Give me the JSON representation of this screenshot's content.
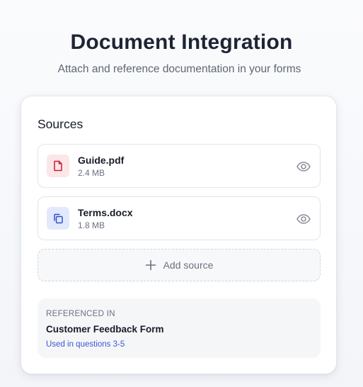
{
  "header": {
    "title": "Document Integration",
    "subtitle": "Attach and reference documentation in your forms"
  },
  "sources": {
    "title": "Sources",
    "items": [
      {
        "name": "Guide.pdf",
        "size": "2.4 MB",
        "icon": "pdf-file-icon",
        "icon_color": "#c81e3a",
        "icon_bg": "#fde6e7"
      },
      {
        "name": "Terms.docx",
        "size": "1.8 MB",
        "icon": "copy-document-icon",
        "icon_color": "#2f4fcf",
        "icon_bg": "#e2e9fd"
      }
    ],
    "view_icon": "eye-icon",
    "add_label": "Add source"
  },
  "referenced": {
    "label": "REFERENCED IN",
    "form_name": "Customer Feedback Form",
    "usage": "Used in questions 3-5",
    "usage_color": "#3b57d6"
  }
}
